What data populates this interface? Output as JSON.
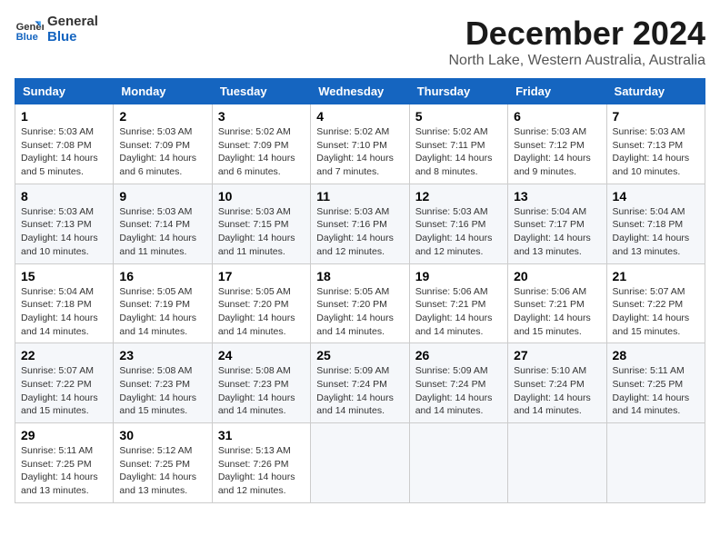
{
  "logo": {
    "line1": "General",
    "line2": "Blue"
  },
  "title": "December 2024",
  "subtitle": "North Lake, Western Australia, Australia",
  "headers": [
    "Sunday",
    "Monday",
    "Tuesday",
    "Wednesday",
    "Thursday",
    "Friday",
    "Saturday"
  ],
  "weeks": [
    [
      {
        "day": "1",
        "sunrise": "5:03 AM",
        "sunset": "7:08 PM",
        "daylight": "14 hours and 5 minutes."
      },
      {
        "day": "2",
        "sunrise": "5:03 AM",
        "sunset": "7:09 PM",
        "daylight": "14 hours and 6 minutes."
      },
      {
        "day": "3",
        "sunrise": "5:02 AM",
        "sunset": "7:09 PM",
        "daylight": "14 hours and 6 minutes."
      },
      {
        "day": "4",
        "sunrise": "5:02 AM",
        "sunset": "7:10 PM",
        "daylight": "14 hours and 7 minutes."
      },
      {
        "day": "5",
        "sunrise": "5:02 AM",
        "sunset": "7:11 PM",
        "daylight": "14 hours and 8 minutes."
      },
      {
        "day": "6",
        "sunrise": "5:03 AM",
        "sunset": "7:12 PM",
        "daylight": "14 hours and 9 minutes."
      },
      {
        "day": "7",
        "sunrise": "5:03 AM",
        "sunset": "7:13 PM",
        "daylight": "14 hours and 10 minutes."
      }
    ],
    [
      {
        "day": "8",
        "sunrise": "5:03 AM",
        "sunset": "7:13 PM",
        "daylight": "14 hours and 10 minutes."
      },
      {
        "day": "9",
        "sunrise": "5:03 AM",
        "sunset": "7:14 PM",
        "daylight": "14 hours and 11 minutes."
      },
      {
        "day": "10",
        "sunrise": "5:03 AM",
        "sunset": "7:15 PM",
        "daylight": "14 hours and 11 minutes."
      },
      {
        "day": "11",
        "sunrise": "5:03 AM",
        "sunset": "7:16 PM",
        "daylight": "14 hours and 12 minutes."
      },
      {
        "day": "12",
        "sunrise": "5:03 AM",
        "sunset": "7:16 PM",
        "daylight": "14 hours and 12 minutes."
      },
      {
        "day": "13",
        "sunrise": "5:04 AM",
        "sunset": "7:17 PM",
        "daylight": "14 hours and 13 minutes."
      },
      {
        "day": "14",
        "sunrise": "5:04 AM",
        "sunset": "7:18 PM",
        "daylight": "14 hours and 13 minutes."
      }
    ],
    [
      {
        "day": "15",
        "sunrise": "5:04 AM",
        "sunset": "7:18 PM",
        "daylight": "14 hours and 14 minutes."
      },
      {
        "day": "16",
        "sunrise": "5:05 AM",
        "sunset": "7:19 PM",
        "daylight": "14 hours and 14 minutes."
      },
      {
        "day": "17",
        "sunrise": "5:05 AM",
        "sunset": "7:20 PM",
        "daylight": "14 hours and 14 minutes."
      },
      {
        "day": "18",
        "sunrise": "5:05 AM",
        "sunset": "7:20 PM",
        "daylight": "14 hours and 14 minutes."
      },
      {
        "day": "19",
        "sunrise": "5:06 AM",
        "sunset": "7:21 PM",
        "daylight": "14 hours and 14 minutes."
      },
      {
        "day": "20",
        "sunrise": "5:06 AM",
        "sunset": "7:21 PM",
        "daylight": "14 hours and 15 minutes."
      },
      {
        "day": "21",
        "sunrise": "5:07 AM",
        "sunset": "7:22 PM",
        "daylight": "14 hours and 15 minutes."
      }
    ],
    [
      {
        "day": "22",
        "sunrise": "5:07 AM",
        "sunset": "7:22 PM",
        "daylight": "14 hours and 15 minutes."
      },
      {
        "day": "23",
        "sunrise": "5:08 AM",
        "sunset": "7:23 PM",
        "daylight": "14 hours and 15 minutes."
      },
      {
        "day": "24",
        "sunrise": "5:08 AM",
        "sunset": "7:23 PM",
        "daylight": "14 hours and 14 minutes."
      },
      {
        "day": "25",
        "sunrise": "5:09 AM",
        "sunset": "7:24 PM",
        "daylight": "14 hours and 14 minutes."
      },
      {
        "day": "26",
        "sunrise": "5:09 AM",
        "sunset": "7:24 PM",
        "daylight": "14 hours and 14 minutes."
      },
      {
        "day": "27",
        "sunrise": "5:10 AM",
        "sunset": "7:24 PM",
        "daylight": "14 hours and 14 minutes."
      },
      {
        "day": "28",
        "sunrise": "5:11 AM",
        "sunset": "7:25 PM",
        "daylight": "14 hours and 14 minutes."
      }
    ],
    [
      {
        "day": "29",
        "sunrise": "5:11 AM",
        "sunset": "7:25 PM",
        "daylight": "14 hours and 13 minutes."
      },
      {
        "day": "30",
        "sunrise": "5:12 AM",
        "sunset": "7:25 PM",
        "daylight": "14 hours and 13 minutes."
      },
      {
        "day": "31",
        "sunrise": "5:13 AM",
        "sunset": "7:26 PM",
        "daylight": "14 hours and 12 minutes."
      },
      null,
      null,
      null,
      null
    ]
  ],
  "labels": {
    "sunrise": "Sunrise:",
    "sunset": "Sunset:",
    "daylight": "Daylight:"
  }
}
